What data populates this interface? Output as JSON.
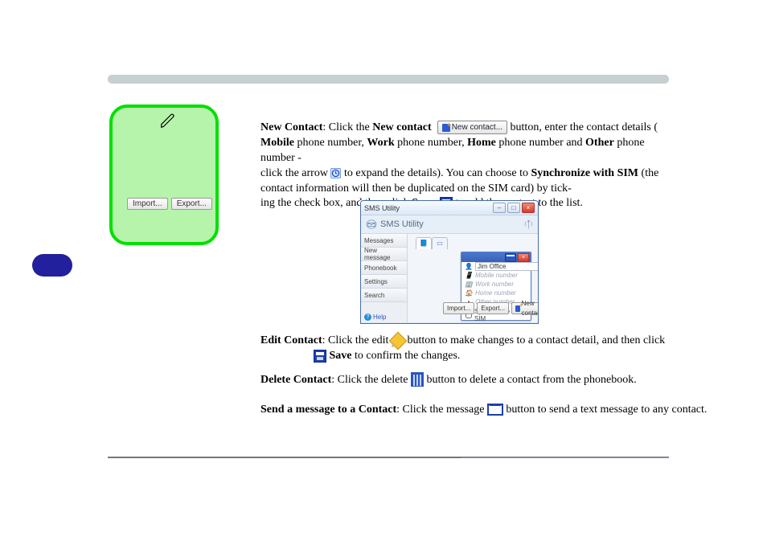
{
  "note": {
    "btn_import": "Import...",
    "btn_export": "Export..."
  },
  "content": {
    "new_contact_b": "New Contact",
    "new_contact_txt": ": Click the ",
    "new_contact_lbl": "New contact",
    "new_contact_btn": "New contact...",
    "fields_b1": "Mobile",
    "fields_b2": "Work",
    "fields_b3": "Home",
    "fields_b4": "Other",
    "txt_line2_a": " button, enter the contact details (",
    "txt_line2_b": " phone number, ",
    "txt_line2_c": " phone number, ",
    "txt_line2_d": " phone number and ",
    "txt_line2_e": " phone number - ",
    "txt_click_arrow": "click the arrow ",
    "txt_expand": " to expand the details). You can choose to ",
    "sync_b": "Synchronize with SIM",
    "txt_tick": " (the contact information will then be duplicated on the SIM card) by tick-",
    "txt_box": "ing the check box, and then click ",
    "save_b": "Save",
    "txt_add": " to add the contact to the list."
  },
  "screenshot": {
    "title": "SMS Utility",
    "band_title": "SMS Utility",
    "sidebar": [
      "Messages",
      "New message",
      "Phonebook",
      "Settings",
      "Search"
    ],
    "help": "Help",
    "name": "Jim Office",
    "ph_mobile": "Mobile number",
    "ph_work": "Work number",
    "ph_home": "Home number",
    "ph_other": "Other number",
    "sync": "Synchronize with SIM",
    "btn_import": "Import...",
    "btn_export": "Export...",
    "btn_new": "New contact..."
  },
  "sections": {
    "edit_b": "Edit Contact",
    "edit_txt": ": Click the edit ",
    "edit_txt2": " button to make changes to a contact detail, and then click ",
    "save2": "Save",
    "edit_txt3": " to confirm the changes.",
    "del_b": "Delete Contact",
    "del_txt": ": Click the delete ",
    "del_txt2": " button to delete a contact from the phonebook.",
    "msg_b": "Send a message to a Contact",
    "msg_txt": ": Click the message ",
    "msg_txt2": " button to send a text message to any contact."
  }
}
